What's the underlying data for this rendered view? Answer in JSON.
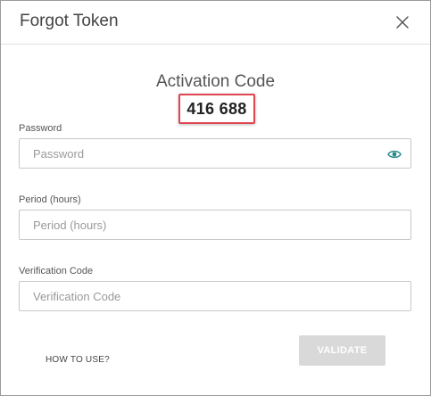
{
  "dialog": {
    "title": "Forgot Token"
  },
  "activation": {
    "label": "Activation Code",
    "code": "416 688",
    "highlight_color": "#e04650"
  },
  "fields": {
    "password": {
      "label": "Password",
      "placeholder": "Password",
      "value": "",
      "icon": "eye-icon",
      "icon_color": "#2c8a8a"
    },
    "period": {
      "label": "Period (hours)",
      "placeholder": "Period (hours)",
      "value": ""
    },
    "verification": {
      "label": "Verification Code",
      "placeholder": "Verification Code",
      "value": ""
    }
  },
  "footer": {
    "how_to_label": "HOW TO USE?",
    "validate_label": "VALIDATE",
    "validate_bg": "#d9d9d9"
  }
}
